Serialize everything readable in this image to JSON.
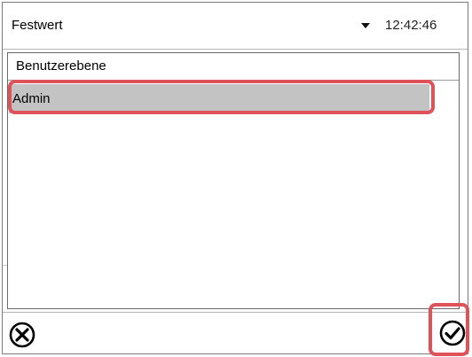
{
  "header": {
    "title": "Festwert",
    "time": "12:42:46"
  },
  "panel": {
    "title": "Benutzerebene",
    "items": [
      {
        "label": "Admin",
        "selected": true
      }
    ]
  },
  "footer": {
    "cancel_icon": "circle-x-icon",
    "confirm_icon": "circle-check-icon"
  },
  "colors": {
    "highlight": "#e0525a",
    "selected_row": "#c3c3c3"
  }
}
